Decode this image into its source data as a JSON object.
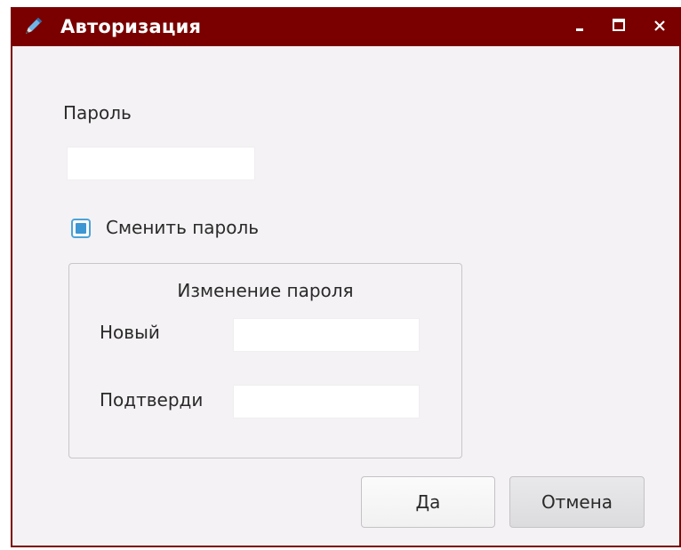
{
  "window": {
    "title": "Авторизация",
    "accent_color": "#7a0000"
  },
  "titlebar_controls": {
    "minimize_icon": "minimize-icon",
    "maximize_icon": "maximize-icon",
    "close_icon": "close-icon",
    "app_icon": "pencil-icon"
  },
  "password": {
    "label": "Пароль",
    "value": "",
    "placeholder": ""
  },
  "change_password": {
    "label": "Сменить пароль",
    "checked": true
  },
  "change_group": {
    "title": "Изменение пароля",
    "new_label": "Новый",
    "new_value": "",
    "confirm_label": "Подтверди",
    "confirm_value": ""
  },
  "buttons": {
    "ok_label": "Да",
    "cancel_label": "Отмена"
  }
}
